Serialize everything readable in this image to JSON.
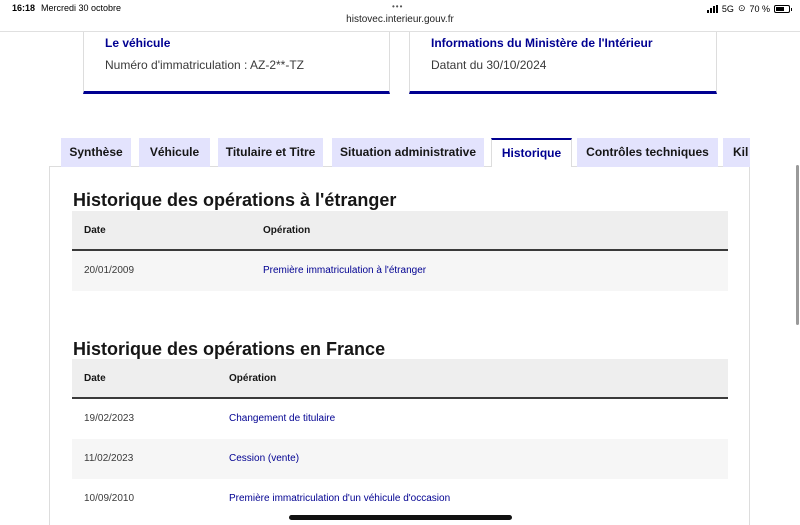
{
  "status_bar": {
    "time": "16:18",
    "date": "Mercredi 30 octobre",
    "url": "histovec.interieur.gouv.fr",
    "network": "5G",
    "battery": "70 %",
    "battery_level": 0.7
  },
  "cards": {
    "vehicle": {
      "title": "Le véhicule",
      "text": "Numéro d'immatriculation : AZ-2**-TZ"
    },
    "ministry": {
      "title": "Informations du Ministère de l'Intérieur",
      "text": "Datant du 30/10/2024"
    }
  },
  "tabs": [
    {
      "label": "Synthèse",
      "active": false
    },
    {
      "label": "Véhicule",
      "active": false
    },
    {
      "label": "Titulaire et Titre",
      "active": false
    },
    {
      "label": "Situation administrative",
      "active": false
    },
    {
      "label": "Historique",
      "active": true
    },
    {
      "label": "Contrôles techniques",
      "active": false
    },
    {
      "label": "Kil",
      "active": false
    }
  ],
  "abroad": {
    "title": "Historique des opérations à l'étranger",
    "columns": [
      "Date",
      "Opération"
    ],
    "rows": [
      {
        "date": "20/01/2009",
        "operation": "Première immatriculation à l'étranger"
      }
    ]
  },
  "france": {
    "title": "Historique des opérations en France",
    "columns": [
      "Date",
      "Opération"
    ],
    "rows": [
      {
        "date": "19/02/2023",
        "operation": "Changement de titulaire"
      },
      {
        "date": "11/02/2023",
        "operation": "Cession (vente)"
      },
      {
        "date": "10/09/2010",
        "operation": "Première immatriculation d'un véhicule d'occasion"
      }
    ]
  },
  "colors": {
    "accent": "#000091",
    "tab_bg": "#e3e3fd",
    "header_bg": "#eeeeee"
  }
}
